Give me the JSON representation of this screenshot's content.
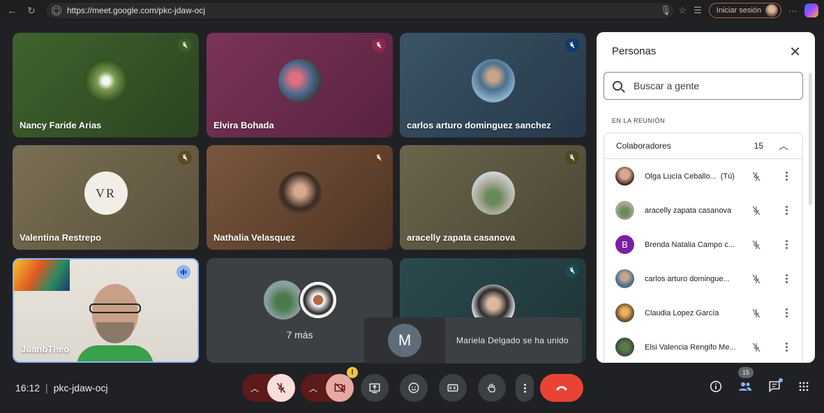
{
  "browser": {
    "url": "https://meet.google.com/pkc-jdaw-ocj",
    "signin_label": "Iniciar sesión"
  },
  "tiles": [
    {
      "name": "Nancy Faride Arias",
      "bg": "#2f4a24",
      "mic_bg": "#3d5c2a"
    },
    {
      "name": "Elvira Bohada",
      "bg": "#6a2a4a",
      "mic_bg": "#8a2a4e"
    },
    {
      "name": "carlos arturo dominguez sanchez",
      "bg": "#2f4453",
      "mic_bg": "#123a6a"
    },
    {
      "name": "Valentina Restrepo",
      "bg": "#6b6048",
      "mic_bg": "#5a4a20"
    },
    {
      "name": "Nathalia Velasquez",
      "bg": "#6a4a36",
      "mic_bg": "#6a3a20"
    },
    {
      "name": "aracelly zapata casanova",
      "bg": "#5b5844",
      "mic_bg": "#4a4a20"
    },
    {
      "name": "JuanbTheo"
    },
    {
      "name": "7 más"
    },
    {
      "name": ""
    }
  ],
  "tile_avatars": {
    "valentina_logo": "VR"
  },
  "toast": {
    "initial": "M",
    "message": "Mariela Delgado se ha unido"
  },
  "meeting": {
    "time": "16:12",
    "separator": "|",
    "code": "pkc-jdaw-ocj"
  },
  "people_panel": {
    "title": "Personas",
    "search_placeholder": "Buscar a gente",
    "section_label": "EN LA REUNIÓN",
    "group_label": "Colaboradores",
    "group_count": "15",
    "participants": [
      {
        "name": "Olga Lucía Ceballo...",
        "tag": "(Tú)"
      },
      {
        "name": "aracelly zapata casanova"
      },
      {
        "name": "Brenda Natalia Campo c...",
        "initial": "B"
      },
      {
        "name": "carlos arturo domingue..."
      },
      {
        "name": "Claudia Lopez García"
      },
      {
        "name": "Elsi Valencia Rengifo Me..."
      }
    ]
  },
  "toolbar": {
    "people_badge": "15"
  }
}
